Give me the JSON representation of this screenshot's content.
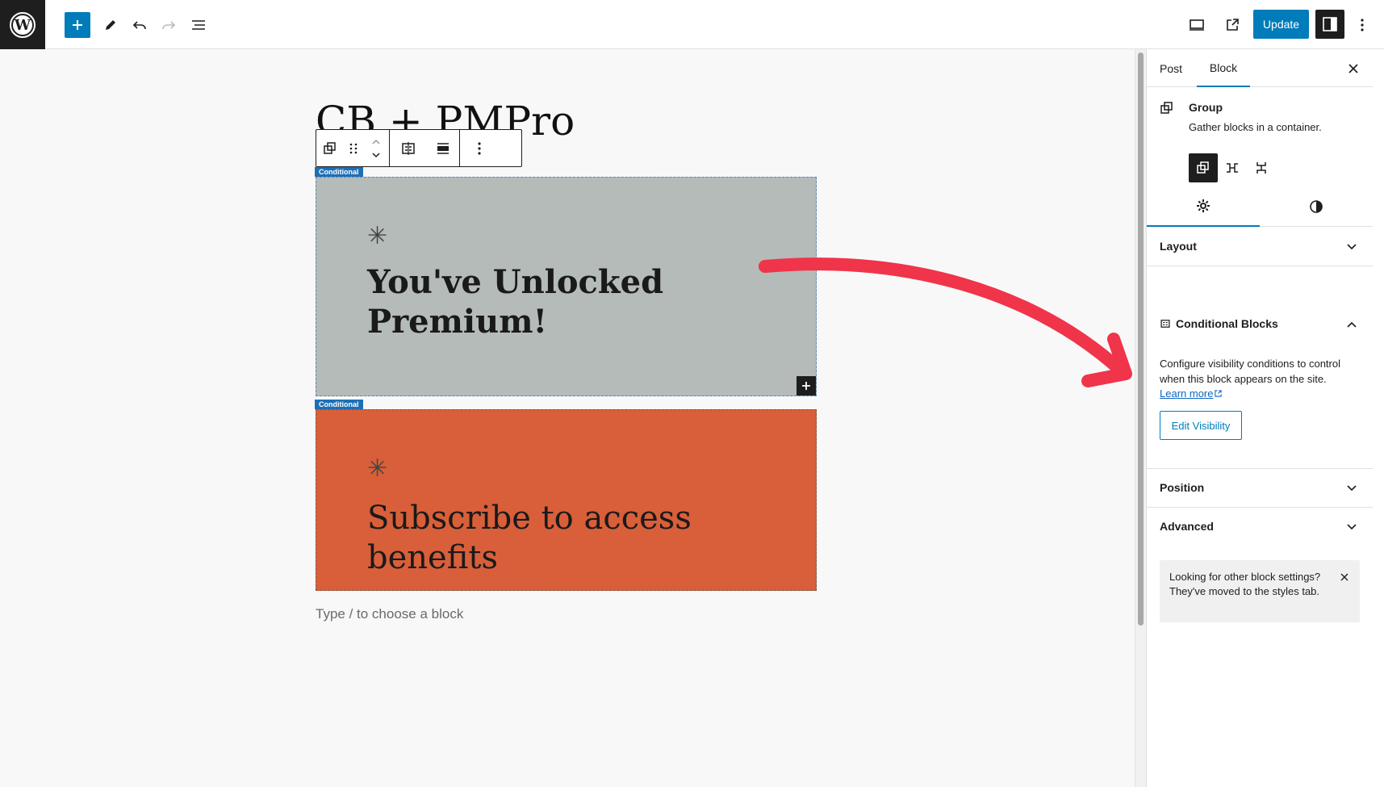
{
  "topbar": {
    "logo_icon": "wordpress-logo-icon",
    "add_icon": "plus-icon",
    "tools_icon": "pencil-icon",
    "undo_icon": "undo-icon",
    "redo_icon": "redo-icon",
    "list_view_icon": "list-view-icon",
    "preview_icon": "desktop-preview-icon",
    "view_post_icon": "external-link-icon",
    "update_label": "Update",
    "settings_icon": "sidebar-toggle-icon",
    "options_icon": "more-vertical-icon"
  },
  "canvas": {
    "post_title": "CB + PMPro",
    "toolbar": {
      "group_icon": "group-block-icon",
      "drag_icon": "drag-handle-icon",
      "move_icon": "move-up-down-icon",
      "conditional_icon": "conditional-blocks-icon",
      "align_icon": "align-full-icon",
      "more_icon": "more-vertical-icon"
    },
    "blocks": [
      {
        "badge": "Conditional",
        "asterisk": "✳",
        "heading": "You've Unlocked Premium!",
        "color": "#b4bbb9"
      },
      {
        "badge": "Conditional",
        "asterisk": "✳",
        "heading": "Subscribe to access benefits",
        "color": "#d85f39"
      }
    ],
    "placeholder": "Type / to choose a block"
  },
  "sidebar": {
    "tabs": [
      {
        "label": "Post",
        "active": false
      },
      {
        "label": "Block",
        "active": true
      }
    ],
    "close_icon": "close-icon",
    "block_card": {
      "icon": "group-block-icon",
      "title": "Group",
      "description": "Gather blocks in a container."
    },
    "variations": [
      "group-icon",
      "row-icon",
      "stack-icon"
    ],
    "inner_tabs": [
      "settings-gear-icon",
      "styles-contrast-icon"
    ],
    "panels": {
      "layout": "Layout",
      "conditional_blocks": {
        "title": "Conditional Blocks",
        "description": "Configure visibility conditions to control when this block appears on the site.",
        "learn_more": "Learn more",
        "edit_button": "Edit Visibility"
      },
      "position": "Position",
      "advanced": "Advanced"
    },
    "notice": "Looking for other block settings? They've moved to the styles tab."
  },
  "annotation": {
    "arrow_color": "#f0344a"
  }
}
